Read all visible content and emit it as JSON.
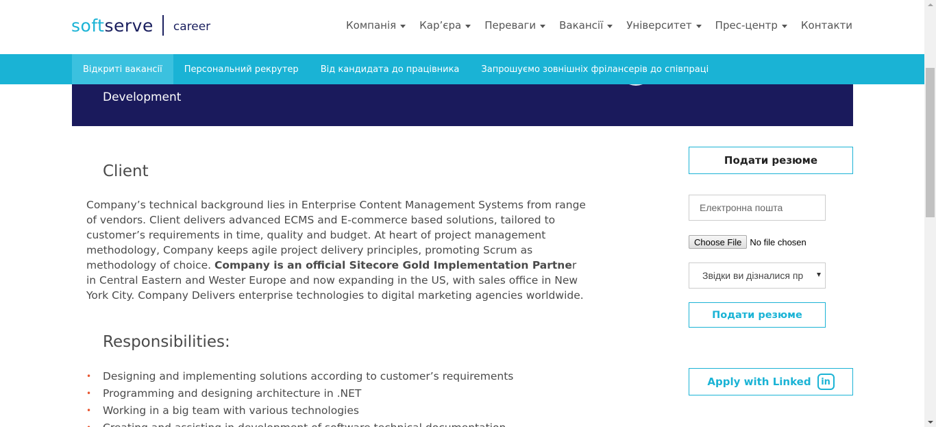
{
  "header": {
    "logo": {
      "soft": "soft",
      "serve": "serve",
      "career": "career"
    },
    "nav": [
      {
        "label": "Компанія",
        "dropdown": true
      },
      {
        "label": "Кар’єра",
        "dropdown": true
      },
      {
        "label": "Переваги",
        "dropdown": true
      },
      {
        "label": "Вакансії",
        "dropdown": true
      },
      {
        "label": "Університет",
        "dropdown": true
      },
      {
        "label": "Прес-центр",
        "dropdown": true
      },
      {
        "label": "Контакти",
        "dropdown": false
      }
    ]
  },
  "subnav": [
    {
      "label": "Відкриті вакансії",
      "active": true
    },
    {
      "label": "Персональний рекрутер",
      "active": false
    },
    {
      "label": "Від кандидата до працівника",
      "active": false
    },
    {
      "label": "Запрошуємо зовнішніх фрілансерів до співпраці",
      "active": false
    }
  ],
  "banner": {
    "title_line": "Development"
  },
  "content": {
    "client_heading": "Client",
    "client_text_1": "Company’s technical background lies in Enterprise Content Management Systems from range of vendors. Client delivers advanced ECMS and E-commerce based solutions, tailored to customer’s requirements in time, quality and budget. At heart of project management methodology, Company keeps agile project delivery principles, promoting Scrum as methodology of choice. ",
    "client_text_bold": "Company is an official Sitecore Gold Implementation Partne",
    "client_text_2": "r in Central Eastern and Wester Europe and now expanding in the US, with sales office in New York City. Company Delivers enterprise technologies to digital marketing agencies worldwide.",
    "responsibilities_heading": "Responsibilities:",
    "responsibilities": [
      "Designing and implementing solutions according to customer’s requirements",
      "Programming and designing architecture in .NET",
      "Working in a big team with various technologies",
      "Creating and assisting in development of software technical documentation"
    ]
  },
  "sidebar": {
    "submit_top_label": "Подати резюме",
    "email_placeholder": "Електронна пошта",
    "file_button_label": "Choose File",
    "file_status": "No file chosen",
    "source_select_value": "Звідки ви дізналися пр",
    "submit_form_label": "Подати резюме",
    "linkedin_label": "Apply with Linked",
    "linkedin_icon_text": "in"
  },
  "colors": {
    "accent": "#1ab3d5",
    "brand_dark": "#1a1a5c",
    "bullet": "#e8552f"
  }
}
